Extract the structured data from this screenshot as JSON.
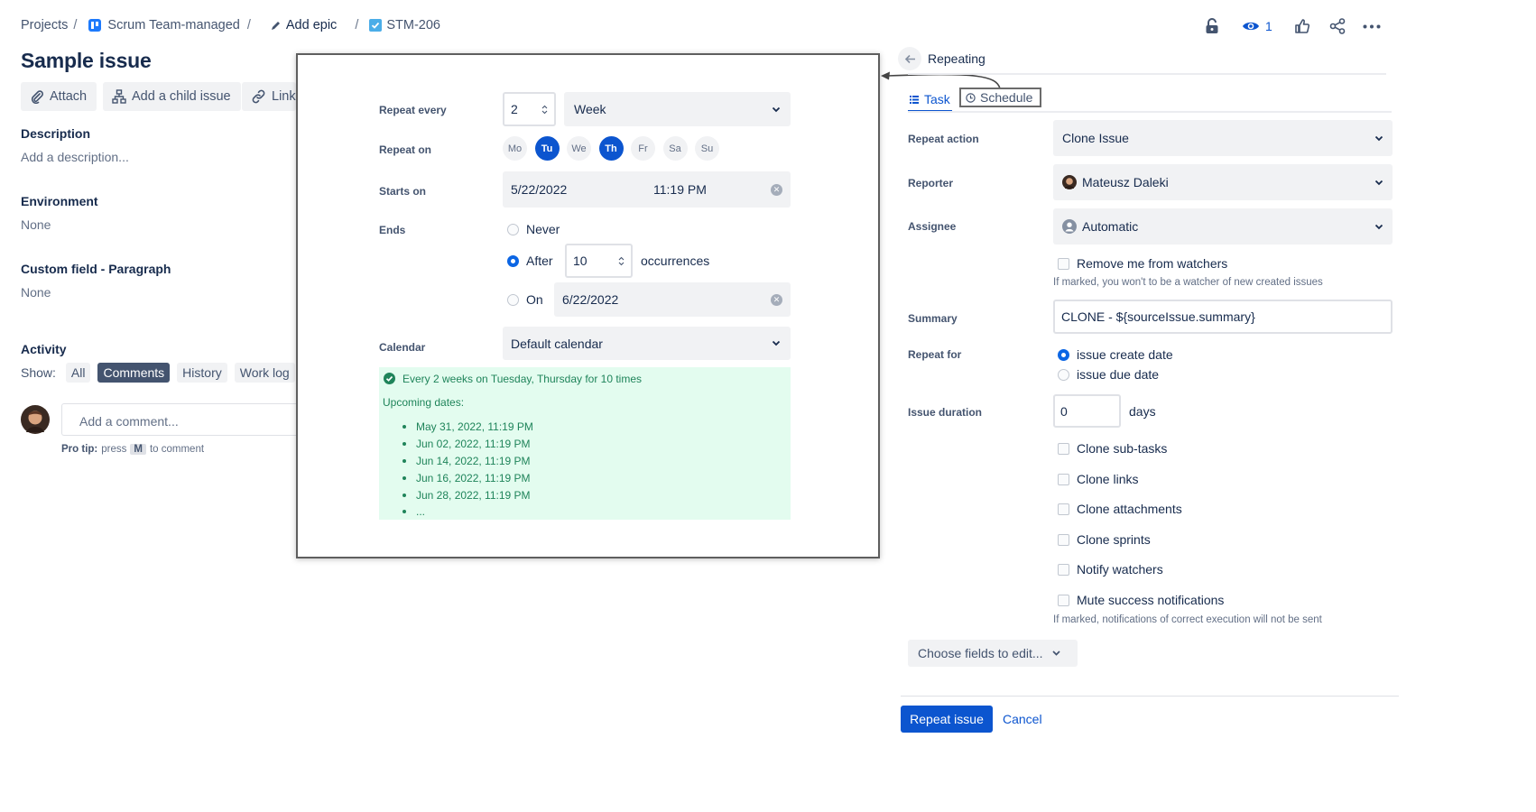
{
  "breadcrumb": {
    "projects": "Projects",
    "project": "Scrum Team-managed",
    "epic": "Add epic",
    "issue_key": "STM-206"
  },
  "header_actions": {
    "watchers_count": "1"
  },
  "issue": {
    "title": "Sample issue",
    "toolbar": {
      "attach": "Attach",
      "add_child": "Add a child issue",
      "link": "Link"
    },
    "description_label": "Description",
    "description_placeholder": "Add a description...",
    "environment_label": "Environment",
    "environment_value": "None",
    "custom_field_label": "Custom field - Paragraph",
    "custom_field_value": "None"
  },
  "activity": {
    "heading": "Activity",
    "show_label": "Show:",
    "filters": [
      "All",
      "Comments",
      "History",
      "Work log"
    ],
    "active_filter": "Comments",
    "comment_placeholder": "Add a comment...",
    "pro_tip_prefix": "Pro tip:",
    "pro_tip_mid": "press",
    "pro_tip_key": "M",
    "pro_tip_suffix": "to comment"
  },
  "schedule_modal": {
    "repeat_every_label": "Repeat every",
    "repeat_every_value": "2",
    "repeat_unit": "Week",
    "repeat_on_label": "Repeat on",
    "days": [
      {
        "label": "Mo",
        "on": false
      },
      {
        "label": "Tu",
        "on": true
      },
      {
        "label": "We",
        "on": false
      },
      {
        "label": "Th",
        "on": true
      },
      {
        "label": "Fr",
        "on": false
      },
      {
        "label": "Sa",
        "on": false
      },
      {
        "label": "Su",
        "on": false
      }
    ],
    "starts_on_label": "Starts on",
    "starts_date": "5/22/2022",
    "starts_time": "11:19 PM",
    "ends_label": "Ends",
    "ends_never": "Never",
    "ends_after": "After",
    "ends_after_value": "10",
    "occurrences": "occurrences",
    "ends_on": "On",
    "ends_on_date": "6/22/2022",
    "selected_end": "After",
    "calendar_label": "Calendar",
    "calendar_value": "Default calendar",
    "summary_text": "Every 2 weeks on Tuesday, Thursday for 10 times",
    "upcoming_label": "Upcoming dates:",
    "upcoming": [
      "May 31, 2022, 11:19 PM",
      "Jun 02, 2022, 11:19 PM",
      "Jun 14, 2022, 11:19 PM",
      "Jun 16, 2022, 11:19 PM",
      "Jun 28, 2022, 11:19 PM",
      "..."
    ]
  },
  "repeating_panel": {
    "title": "Repeating",
    "tabs": {
      "task": "Task",
      "schedule": "Schedule"
    },
    "repeat_action_label": "Repeat action",
    "repeat_action_value": "Clone Issue",
    "reporter_label": "Reporter",
    "reporter_value": "Mateusz Daleki",
    "assignee_label": "Assignee",
    "assignee_value": "Automatic",
    "remove_watchers": "Remove me from watchers",
    "remove_watchers_hint": "If marked, you won't to be a watcher of new created issues",
    "summary_label": "Summary",
    "summary_value": "CLONE - ${sourceIssue.summary}",
    "repeat_for_label": "Repeat for",
    "repeat_for_create": "issue create date",
    "repeat_for_due": "issue due date",
    "issue_duration_label": "Issue duration",
    "issue_duration_value": "0",
    "issue_duration_unit": "days",
    "options": [
      "Clone sub-tasks",
      "Clone links",
      "Clone attachments",
      "Clone sprints",
      "Notify watchers",
      "Mute success notifications"
    ],
    "mute_hint": "If marked, notifications of correct execution will not be sent",
    "choose_fields": "Choose fields to edit...",
    "repeat_button": "Repeat issue",
    "cancel": "Cancel"
  },
  "colors": {
    "primary": "#0c55cf",
    "success_bg": "#e3fcef",
    "success_text": "#1f845a",
    "field_bg": "#f1f2f4"
  }
}
